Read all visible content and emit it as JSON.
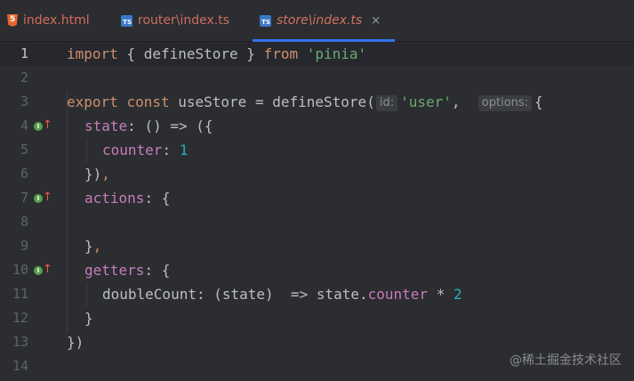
{
  "tabs": [
    {
      "label": "index.html",
      "icon": "html5-icon"
    },
    {
      "label": "router\\index.ts",
      "icon": "typescript-icon"
    },
    {
      "label": "store\\index.ts",
      "icon": "typescript-icon",
      "close": "×"
    }
  ],
  "ts_badge": "TS",
  "gutter_marker": {
    "dot": "I",
    "arrow": "↑"
  },
  "line_numbers": [
    "1",
    "2",
    "3",
    "4",
    "5",
    "6",
    "7",
    "8",
    "9",
    "10",
    "11",
    "12",
    "13",
    "14"
  ],
  "code": {
    "l1": {
      "kw1": "import",
      "t1": " { ",
      "fn": "defineStore",
      "t2": " } ",
      "kw2": "from",
      "sp": " ",
      "str": "'pinia'"
    },
    "l3": {
      "kw1": "export",
      "sp1": " ",
      "kw2": "const",
      "t1": " ",
      "fn1": "useStore",
      "t2": " = ",
      "fn2": "defineStore",
      "t3": "(",
      "hint_id": "id:",
      "str": "'user'",
      "t4": ",  ",
      "hint_options": "options:",
      "t5": "{"
    },
    "l4": {
      "prop": "state",
      "t": ": () => ({"
    },
    "l5": {
      "prop": "counter",
      "t": ": ",
      "num": "1"
    },
    "l6": {
      "t1": "})",
      "kw": ","
    },
    "l7": {
      "prop": "actions",
      "t": ": {"
    },
    "l9": {
      "t1": "}",
      "kw": ","
    },
    "l10": {
      "prop": "getters",
      "t": ": {"
    },
    "l11": {
      "fn": "doubleCount",
      "t1": ": (state)  => state.",
      "prop": "counter",
      "t2": " * ",
      "num": "2"
    },
    "l12": {
      "t": "}"
    },
    "l13": {
      "t": "})"
    }
  },
  "watermark": "@稀土掘金技术社区"
}
